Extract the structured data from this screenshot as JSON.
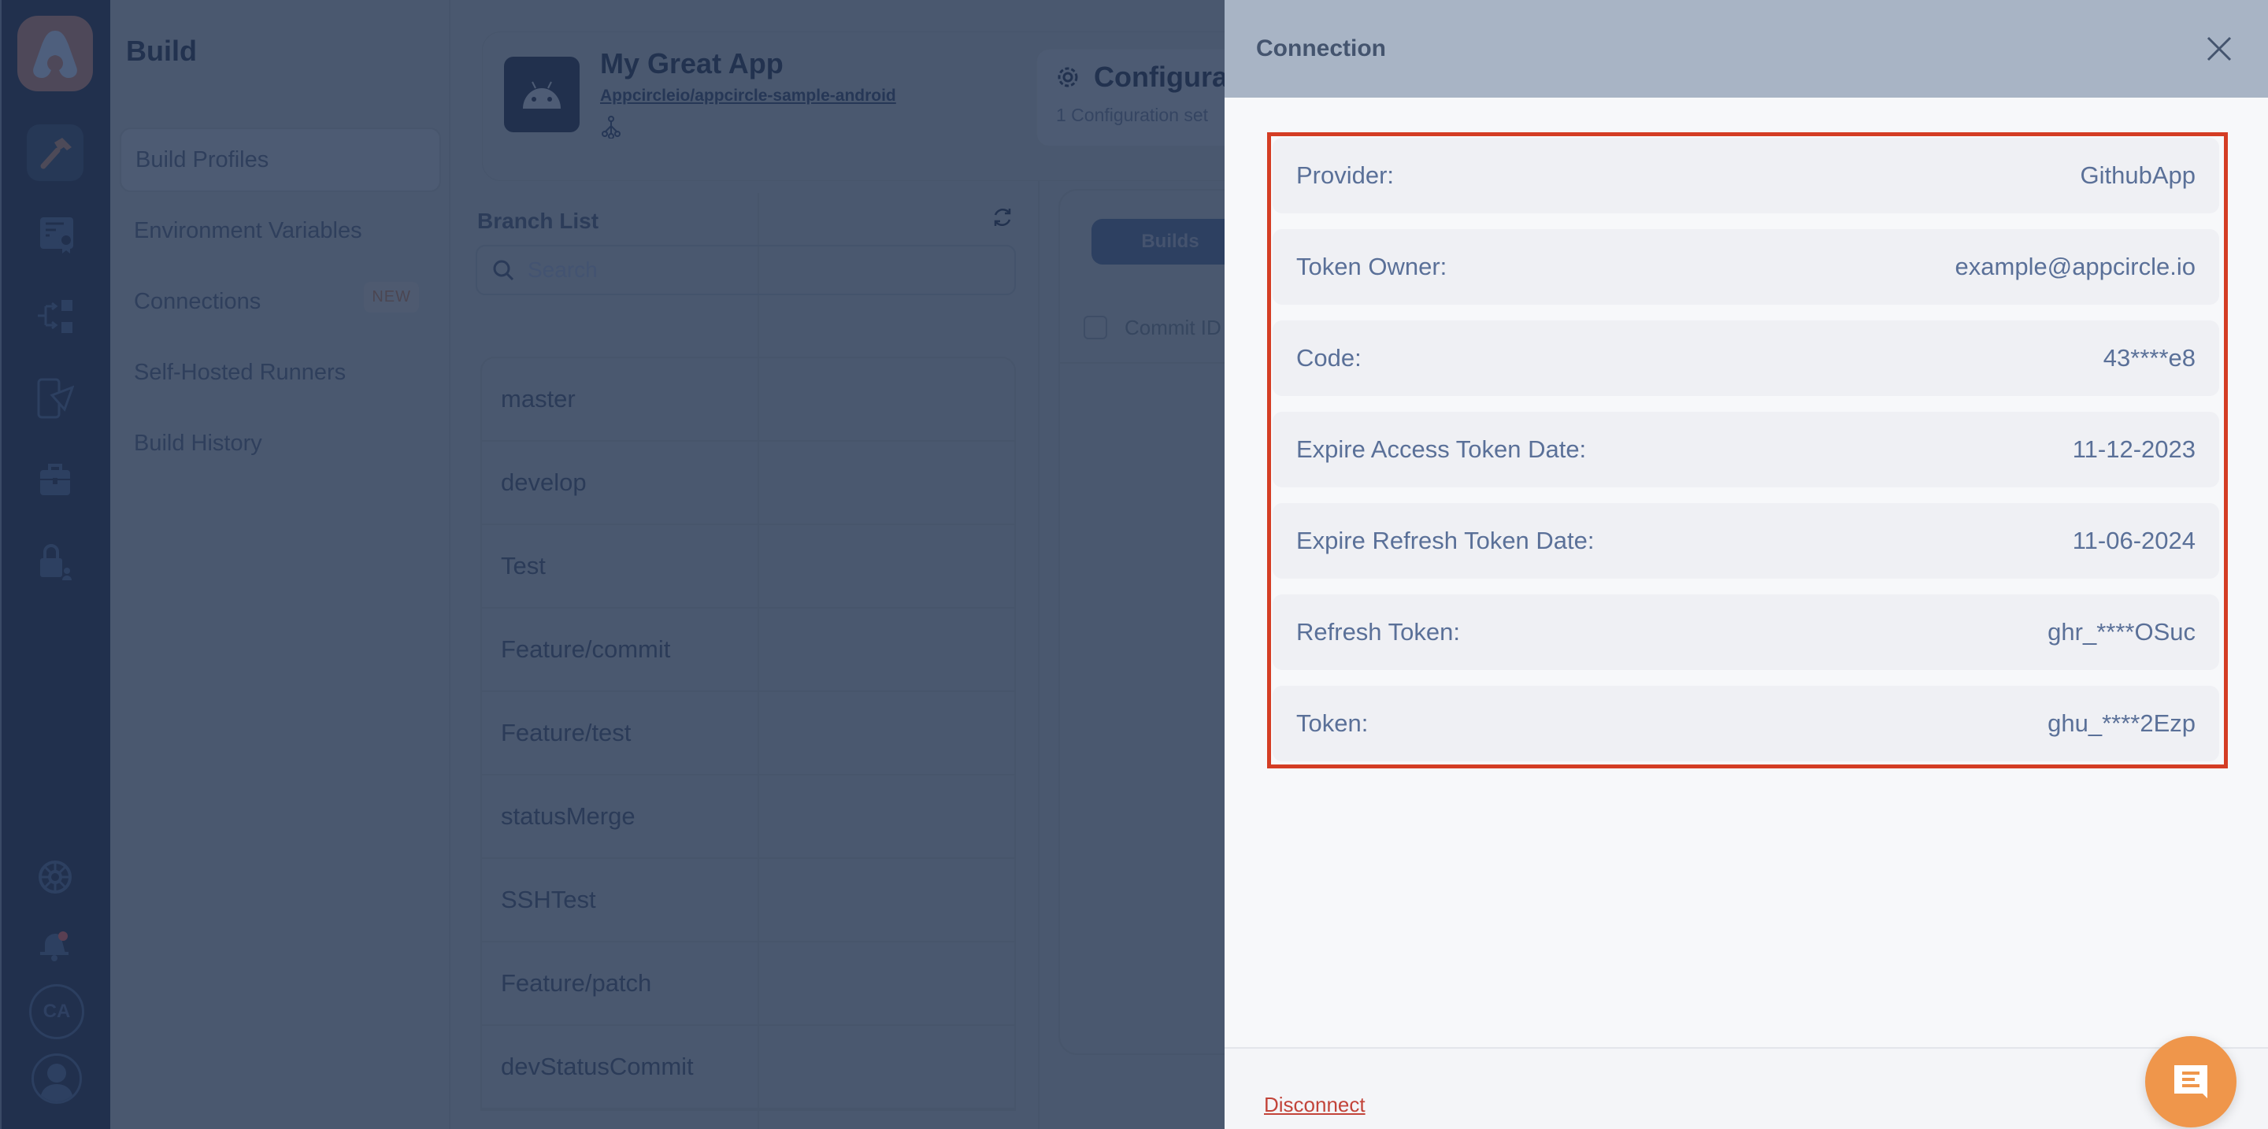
{
  "rail": {
    "logo": "appcircle-logo",
    "icons": [
      "build-hammer-icon",
      "signing-certificate-icon",
      "distribution-flow-icon",
      "testing-distribution-icon",
      "enterprise-store-icon",
      "access-lock-icon"
    ],
    "bottom_icons": [
      "help-lifebuoy-icon",
      "notification-bell-icon"
    ],
    "org_avatar_initials": "CA",
    "user_avatar": "user-avatar-icon"
  },
  "subnav": {
    "title": "Build",
    "items": [
      {
        "label": "Build Profiles",
        "selected": true
      },
      {
        "label": "Environment Variables"
      },
      {
        "label": "Connections",
        "badge": "NEW"
      },
      {
        "label": "Self-Hosted Runners"
      },
      {
        "label": "Build History"
      }
    ]
  },
  "app": {
    "name": "My Great App",
    "repo": "Appcircleio/appcircle-sample-android",
    "config_title": "Configura",
    "config_subtitle": "1 Configuration set"
  },
  "branches": {
    "title": "Branch List",
    "search_placeholder": "Search",
    "items": [
      "master",
      "develop",
      "Test",
      "Feature/commit",
      "Feature/test",
      "statusMerge",
      "SSHTest",
      "Feature/patch",
      "devStatusCommit"
    ]
  },
  "builds": {
    "tab_label": "Builds",
    "column_commit": "Commit ID"
  },
  "drawer": {
    "title": "Connection",
    "rows": [
      {
        "label": "Provider:",
        "value": "GithubApp"
      },
      {
        "label": "Token Owner:",
        "value": "example@appcircle.io"
      },
      {
        "label": "Code:",
        "value": "43****e8"
      },
      {
        "label": "Expire Access Token Date:",
        "value": "11-12-2023"
      },
      {
        "label": "Expire Refresh Token Date:",
        "value": "11-06-2024"
      },
      {
        "label": "Refresh Token:",
        "value": "ghr_****OSuc"
      },
      {
        "label": "Token:",
        "value": "ghu_****2Ezp"
      }
    ],
    "disconnect_label": "Disconnect"
  },
  "colors": {
    "highlight_border": "#d43d24",
    "disconnect": "#c2443a",
    "chat_fab": "#ef964b",
    "drawer_header": "#a8b4c5"
  }
}
